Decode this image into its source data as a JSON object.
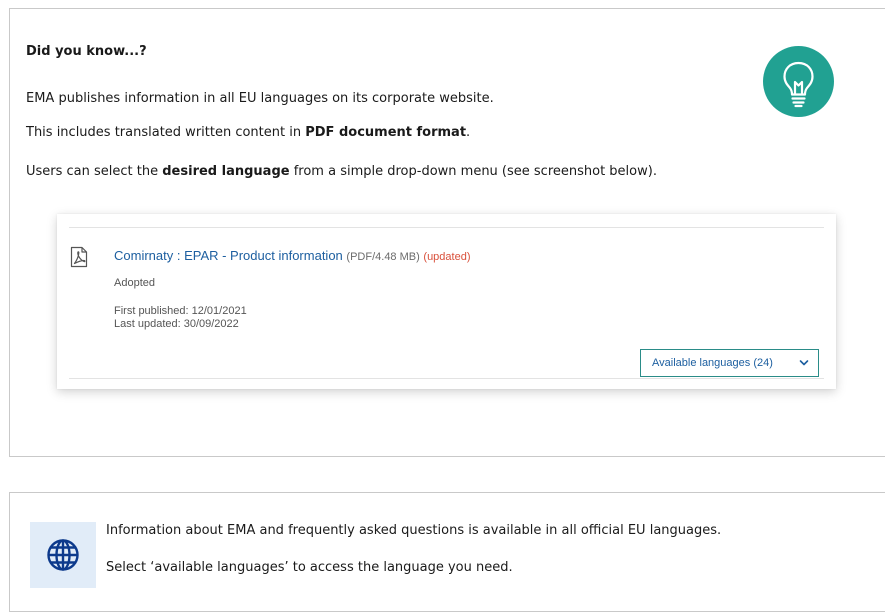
{
  "did_you_know": {
    "title": "Did you know...?",
    "line1": "EMA publishes information in all EU languages on its corporate website.",
    "line2_pre": "This includes translated written content in ",
    "line2_bold": "PDF document format",
    "line2_post": ".",
    "line3_pre": "Users can select the ",
    "line3_bold": "desired language",
    "line3_post": " from a simple drop-down menu (see screenshot below).",
    "icon": "lightbulb-icon",
    "icon_color": "#21a192"
  },
  "document_card": {
    "icon": "pdf-file-icon",
    "title": "Comirnaty : EPAR - Product information",
    "file_info": "(PDF/4.48 MB)",
    "status": "(updated)",
    "state": "Adopted",
    "first_published": "First published: 12/01/2021",
    "last_updated": "Last updated: 30/09/2022",
    "languages_button": "Available languages (24)",
    "dropdown_icon": "chevron-down-icon"
  },
  "info_panel": {
    "icon": "globe-icon",
    "line1": "Information about EMA and frequently asked questions is available in all official EU languages.",
    "line2": "Select ‘available languages’ to access the language you need."
  },
  "colors": {
    "link": "#1d5fa0",
    "updated": "#d9503b",
    "accent_teal": "#21a192",
    "button_border": "#2a8c88",
    "globe_bg": "#e1ecf8",
    "globe": "#0d3a8c"
  }
}
